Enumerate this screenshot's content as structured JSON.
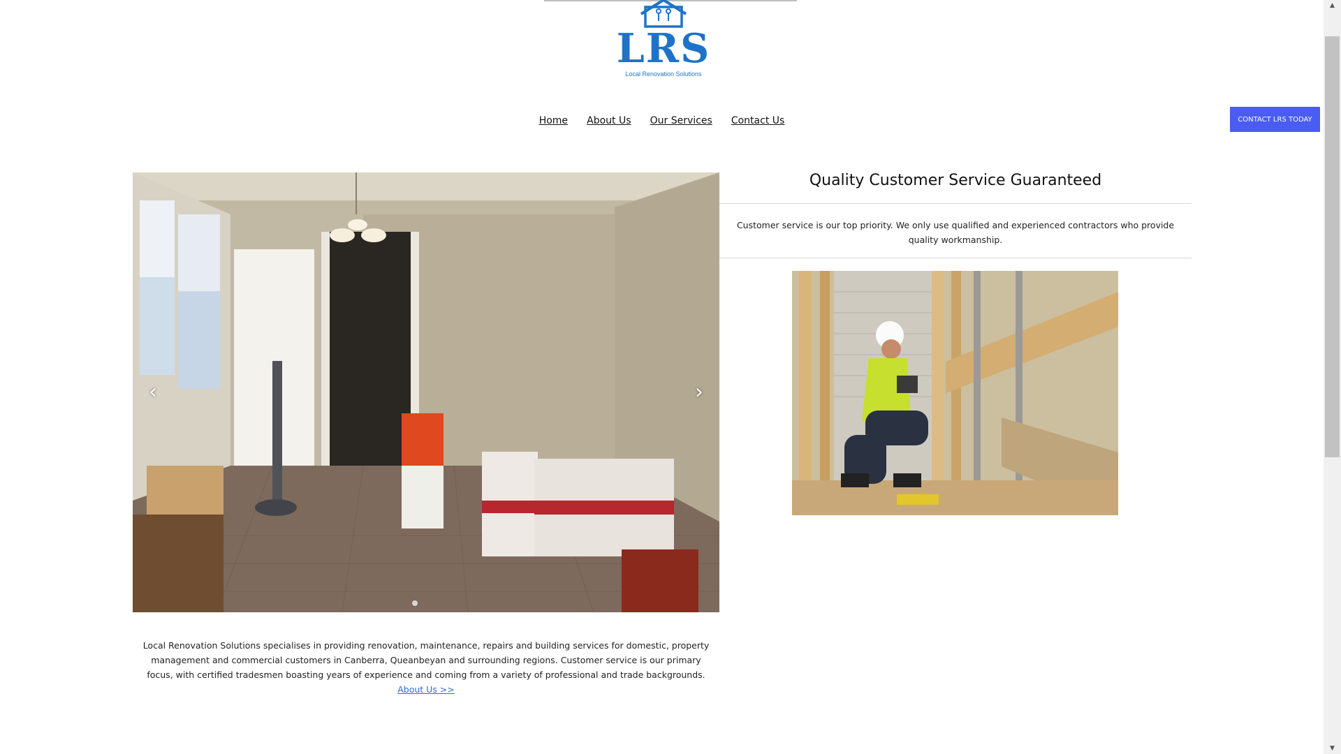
{
  "header": {
    "logo_title": "LRS",
    "logo_subtitle": "Local Renovation Solutions",
    "logo_icons": [
      "house-icon",
      "wrench-icon",
      "tools-icon"
    ]
  },
  "nav": {
    "items": [
      {
        "label": "Home"
      },
      {
        "label": "About Us"
      },
      {
        "label": "Our Services"
      },
      {
        "label": "Contact Us"
      }
    ]
  },
  "cta": {
    "label": "CONTACT LRS TODAY",
    "color": "#4a5cf2"
  },
  "carousel": {
    "prev_icon": "chevron-left-icon",
    "next_icon": "chevron-right-icon",
    "prev_glyph": "‹",
    "next_glyph": "›",
    "slide_count": 1,
    "active_slide": 1
  },
  "feature": {
    "title": "Quality Customer Service Guaranteed",
    "text": "Customer service is our top priority. We only use qualified and experienced contractors who provide quality workmanship."
  },
  "about": {
    "text": "Local Renovation Solutions specialises in providing renovation, maintenance, repairs and building services for domestic, property management and commercial customers in Canberra, Queanbeyan and surrounding regions. Customer service is our primary focus, with certified tradesmen boasting years of experience and coming from a variety of professional and trade backgrounds. ",
    "link_label": "About Us >>"
  },
  "colors": {
    "brand_blue": "#1e73c8",
    "link_blue": "#2d6ad8"
  }
}
